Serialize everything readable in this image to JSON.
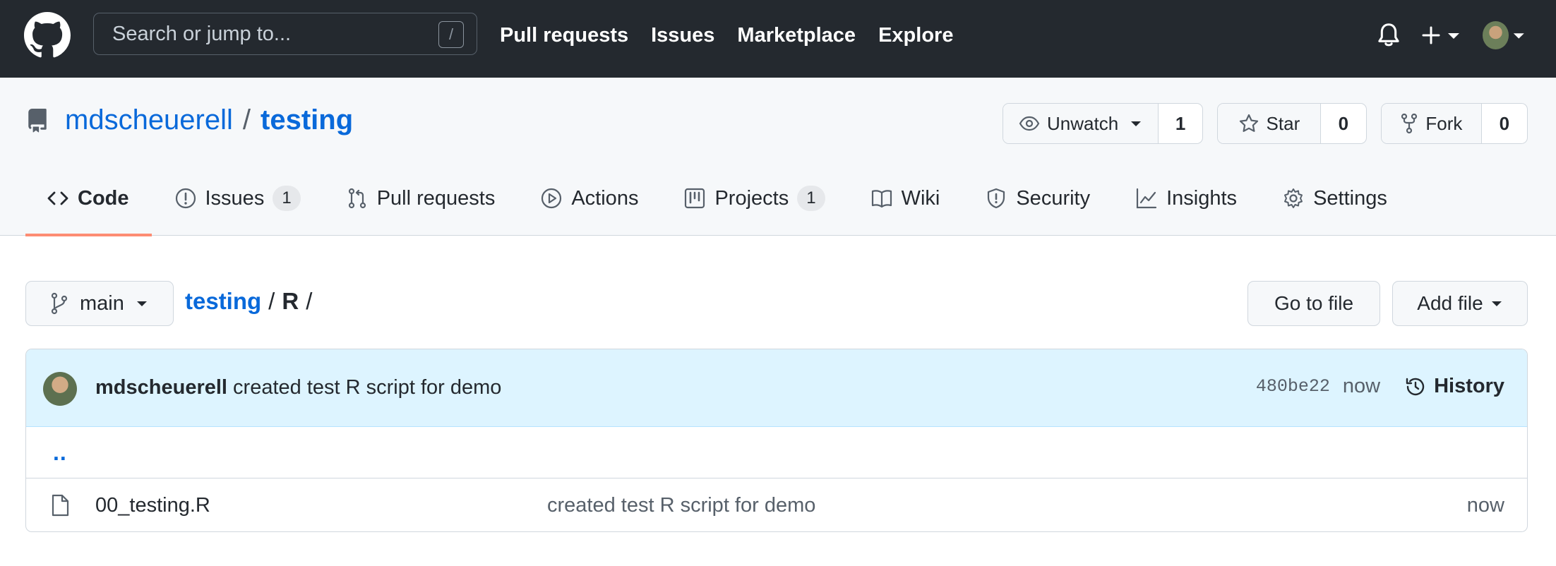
{
  "topbar": {
    "search_placeholder": "Search or jump to...",
    "search_shortcut": "/",
    "nav": [
      "Pull requests",
      "Issues",
      "Marketplace",
      "Explore"
    ]
  },
  "repo": {
    "owner": "mdscheuerell",
    "separator": "/",
    "name": "testing",
    "watch_label": "Unwatch",
    "watch_count": "1",
    "star_label": "Star",
    "star_count": "0",
    "fork_label": "Fork",
    "fork_count": "0"
  },
  "tabs": [
    {
      "label": "Code",
      "icon": "code-icon",
      "selected": true
    },
    {
      "label": "Issues",
      "icon": "issue-icon",
      "counter": "1"
    },
    {
      "label": "Pull requests",
      "icon": "pull-request-icon"
    },
    {
      "label": "Actions",
      "icon": "play-icon"
    },
    {
      "label": "Projects",
      "icon": "project-icon",
      "counter": "1"
    },
    {
      "label": "Wiki",
      "icon": "book-icon"
    },
    {
      "label": "Security",
      "icon": "shield-icon"
    },
    {
      "label": "Insights",
      "icon": "graph-icon"
    },
    {
      "label": "Settings",
      "icon": "gear-icon"
    }
  ],
  "branch": {
    "name": "main",
    "crumb_root": "testing",
    "crumb_sep": "/",
    "crumb_dir": "R",
    "crumb_trailing": "/",
    "go_to_file": "Go to file",
    "add_file": "Add file"
  },
  "commit": {
    "author": "mdscheuerell",
    "message": "created test R script for demo",
    "sha": "480be22",
    "age": "now",
    "history_label": "History"
  },
  "files": {
    "parent_link": "..",
    "rows": [
      {
        "name": "00_testing.R",
        "message": "created test R script for demo",
        "age": "now"
      }
    ]
  },
  "colors": {
    "header_bg": "#24292f",
    "link": "#0969da",
    "tab_underline": "#fd8c73",
    "commit_bg": "#ddf4ff"
  }
}
